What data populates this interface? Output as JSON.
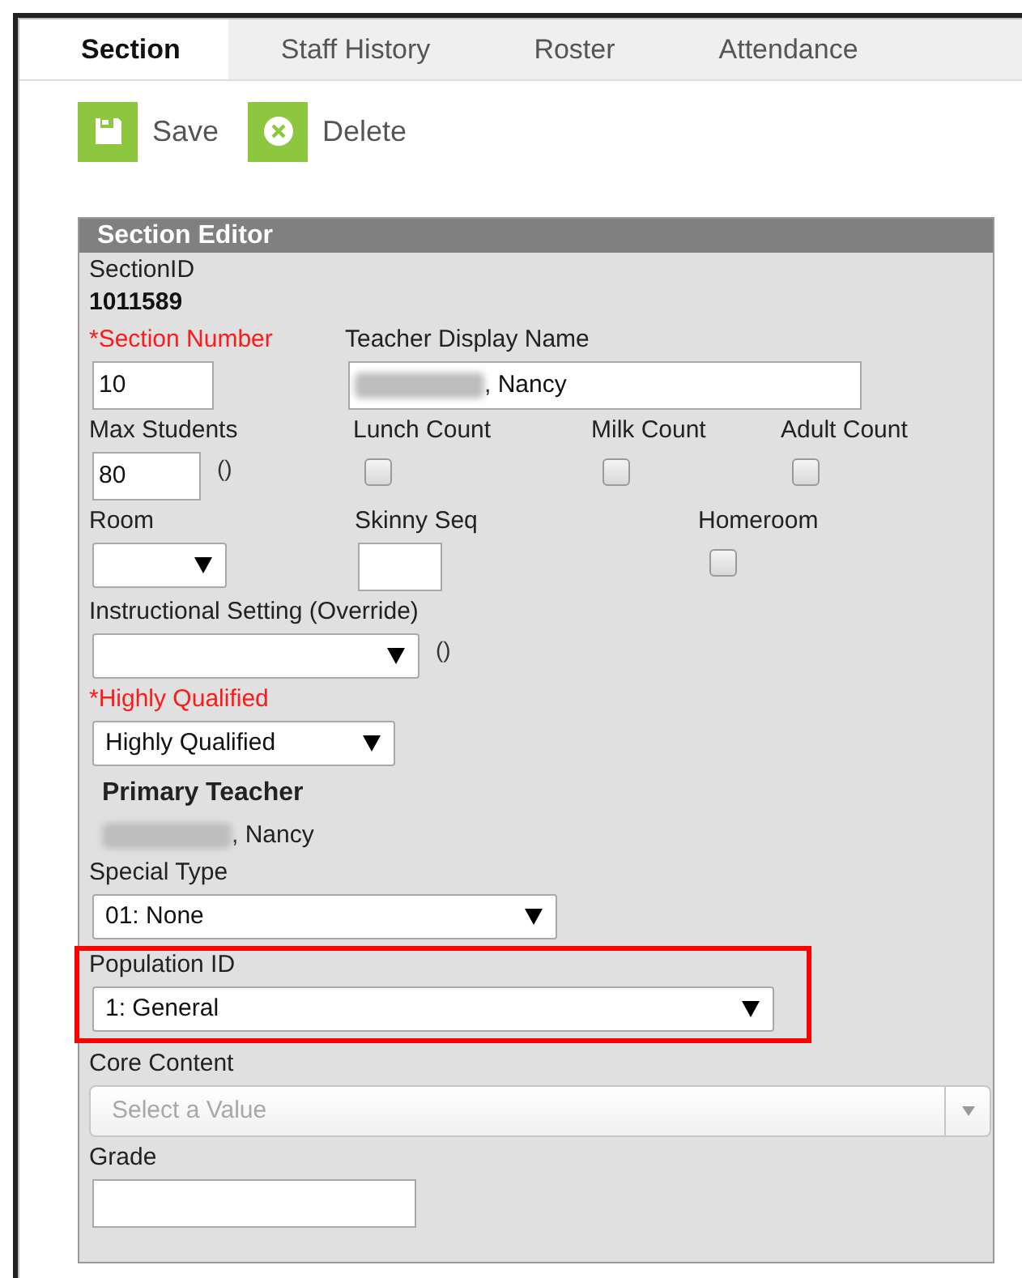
{
  "tabs": [
    {
      "label": "Section",
      "selected": true
    },
    {
      "label": "Staff History",
      "selected": false
    },
    {
      "label": "Roster",
      "selected": false
    },
    {
      "label": "Attendance",
      "selected": false
    }
  ],
  "toolbar": [
    {
      "kind": "save",
      "label": "Save"
    },
    {
      "kind": "delete",
      "label": "Delete"
    }
  ],
  "panel": {
    "title": "Section Editor",
    "rows": [
      [
        {
          "kind": "display",
          "label": "SectionID",
          "required": false,
          "value": "1011589"
        }
      ],
      [
        {
          "kind": "text",
          "label": "*Section Number",
          "required": true,
          "value": "10"
        },
        {
          "kind": "text",
          "label": "Teacher Display Name",
          "required": false,
          "value": ", Nancy",
          "redacted": true
        }
      ],
      [
        {
          "kind": "text",
          "label": "Max Students",
          "required": false,
          "value": "80",
          "note": "()"
        },
        {
          "kind": "checkbox",
          "label": "Lunch Count",
          "checked": false
        },
        {
          "kind": "checkbox",
          "label": "Milk Count",
          "checked": false
        },
        {
          "kind": "checkbox",
          "label": "Adult Count",
          "checked": false
        }
      ],
      [
        {
          "kind": "select",
          "label": "Room",
          "required": false
        },
        {
          "kind": "text",
          "label": "Skinny Seq",
          "required": false
        },
        {
          "kind": "checkbox",
          "label": "Homeroom",
          "checked": false
        }
      ],
      [
        {
          "kind": "select",
          "label": "Instructional Setting (Override)",
          "required": false,
          "note": "()"
        }
      ],
      [
        {
          "kind": "select",
          "label": "*Highly Qualified",
          "required": true,
          "value": "Highly Qualified"
        }
      ],
      [
        {
          "kind": "static",
          "label": "Primary Teacher",
          "value": ", Nancy",
          "redacted": true
        }
      ],
      [
        {
          "kind": "select",
          "label": "Special Type",
          "required": false,
          "value": "01: None"
        }
      ],
      [
        {
          "kind": "select",
          "label": "Population ID",
          "required": false,
          "value": "1: General",
          "highlighted": true
        }
      ],
      [
        {
          "kind": "combo",
          "label": "Core Content",
          "required": false,
          "placeholder": "Select a Value"
        }
      ],
      [
        {
          "kind": "text",
          "label": "Grade",
          "required": false
        }
      ]
    ]
  }
}
